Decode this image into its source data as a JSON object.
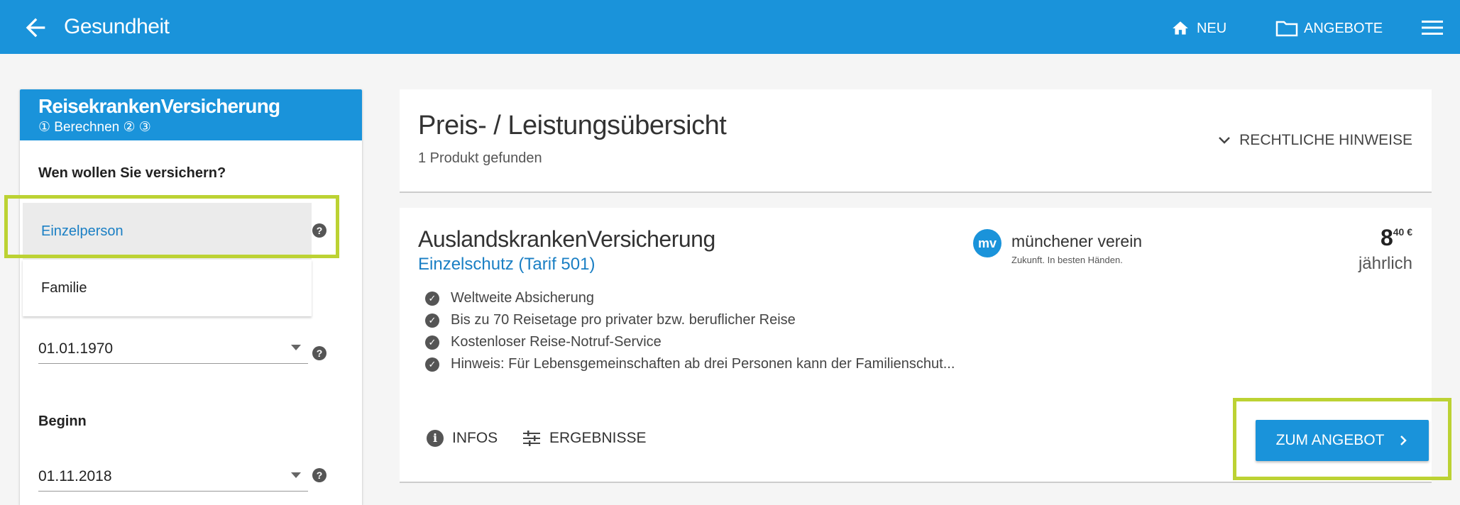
{
  "appbar": {
    "title": "Gesundheit",
    "nav_new": "NEU",
    "nav_offers": "ANGEBOTE",
    "color": "#1a93da"
  },
  "sidebar": {
    "title": "ReisekrankenVersicherung",
    "steps": "① Berechnen ② ③",
    "question": "Wen wollen Sie versichern?",
    "options": [
      "Einzelperson",
      "Familie"
    ],
    "selected_option": "Einzelperson",
    "birthdate": "01.01.1970",
    "start_label": "Beginn",
    "start_date": "01.11.2018"
  },
  "overview": {
    "title": "Preis- / Leistungsübersicht",
    "count": "1 Produkt gefunden",
    "legal_label": "RECHTLICHE HINWEISE"
  },
  "product": {
    "name": "AuslandskrankenVersicherung",
    "tariff": "Einzelschutz (Tarif 501)",
    "insurer_logo_text": "mv",
    "insurer_name": "münchener verein",
    "insurer_tagline": "Zukunft. In besten Händen.",
    "price_main": "8",
    "price_cents": "40 €",
    "price_period": "jährlich",
    "features": [
      "Weltweite Absicherung",
      "Bis zu 70 Reisetage pro privater bzw. beruflicher Reise",
      "Kostenloser Reise-Notruf-Service",
      "Hinweis: Für Lebensgemeinschaften ab drei Personen kann der Familienschut..."
    ],
    "infos_label": "INFOS",
    "results_label": "ERGEBNISSE",
    "cta_label": "ZUM ANGEBOT",
    "highlight_color": "#bcd233"
  }
}
